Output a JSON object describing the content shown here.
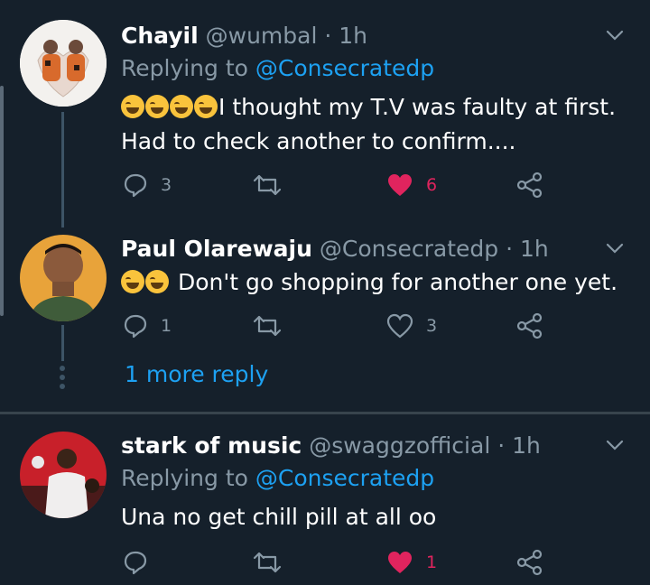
{
  "tweets": [
    {
      "name": "Chayil",
      "handle": "@wumbal",
      "dot": "·",
      "time": "1h",
      "replying_prefix": "Replying to ",
      "replying_to": "@Consecratedp",
      "text_line1": "I thought my T.V was faulty at first.",
      "text_line2": "Had to check another to confirm....",
      "emojis": [
        "rolling-laughing",
        "rolling-laughing",
        "rolling-laughing",
        "rolling-laughing"
      ],
      "reply_count": "3",
      "retweet_count": "",
      "like_count": "6",
      "liked": true
    },
    {
      "name": "Paul Olarewaju",
      "handle": "@Consecratedp",
      "dot": "·",
      "time": "1h",
      "text_line1": "Don't go shopping for another one yet.",
      "emojis": [
        "tears-of-joy",
        "grinning-sweat"
      ],
      "reply_count": "1",
      "retweet_count": "",
      "like_count": "3",
      "liked": false
    },
    {
      "name": "stark of music",
      "handle": "@swaggzofficial",
      "dot": "·",
      "time": "1h",
      "replying_prefix": "Replying to ",
      "replying_to": "@Consecratedp",
      "text_line1": "Una no get chill pill at all oo",
      "reply_count": "",
      "retweet_count": "",
      "like_count": "1",
      "liked": true
    }
  ],
  "more_reply": "1 more reply",
  "colors": {
    "background": "#15202b",
    "accent": "#1da1f2",
    "muted": "#8899a6",
    "like": "#e0245e"
  },
  "icons": [
    "chevron-down-icon",
    "reply-icon",
    "retweet-icon",
    "heart-icon",
    "share-icon"
  ]
}
